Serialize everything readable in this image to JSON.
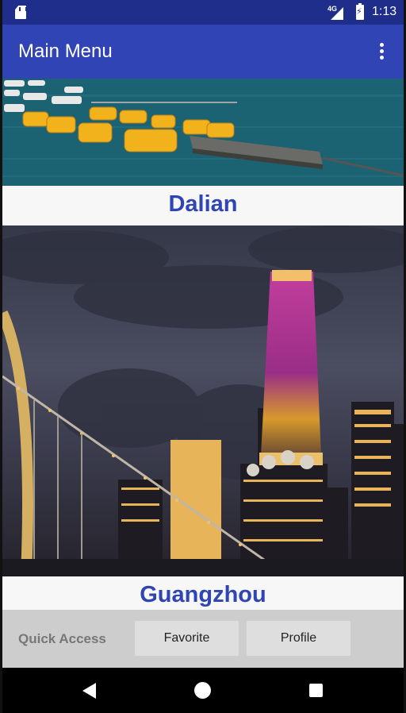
{
  "status_bar": {
    "network": "4G",
    "time": "1:13"
  },
  "app_bar": {
    "title": "Main Menu"
  },
  "cities": [
    {
      "name": "Dalian"
    },
    {
      "name": "Guangzhou"
    }
  ],
  "quick_access": {
    "label": "Quick Access",
    "buttons": [
      "Favorite",
      "Profile"
    ]
  },
  "icons": {
    "status": [
      "sd-card-icon",
      "signal-icon",
      "battery-charging-icon"
    ],
    "app_bar": [
      "overflow-menu-icon"
    ],
    "nav": [
      "back-icon",
      "home-icon",
      "recents-icon"
    ]
  },
  "colors": {
    "status_bar": "#1e2e8a",
    "app_bar": "#3044b5",
    "caption_text": "#2f45b4",
    "quick_bar": "#cdcdcd"
  }
}
